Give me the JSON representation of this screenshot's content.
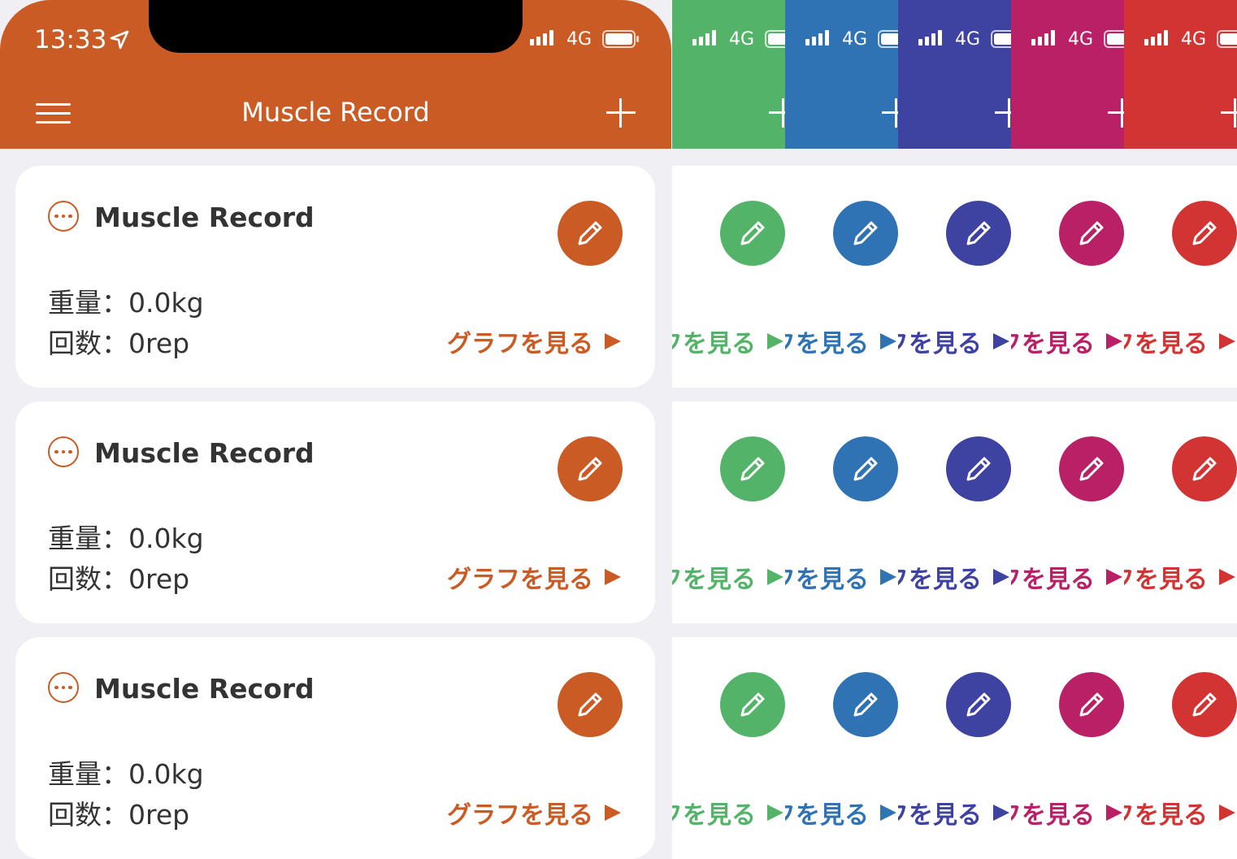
{
  "status_bar": {
    "time": "13:33",
    "network": "4G"
  },
  "header": {
    "title": "Muscle Record"
  },
  "cards": [
    {
      "title": "Muscle Record",
      "weight_text": "重量：0.0kg",
      "reps_text": "回数：0rep",
      "link_label": "グラフを見る"
    },
    {
      "title": "Muscle Record",
      "weight_text": "重量：0.0kg",
      "reps_text": "回数：0rep",
      "link_label": "グラフを見る"
    },
    {
      "title": "Muscle Record",
      "weight_text": "重量：0.0kg",
      "reps_text": "回数：0rep",
      "link_label": "グラフを見る"
    }
  ],
  "themes": [
    {
      "name": "orange",
      "color": "#CB5B24"
    },
    {
      "name": "green",
      "color": "#53B469"
    },
    {
      "name": "blue",
      "color": "#2F73B5"
    },
    {
      "name": "indigo",
      "color": "#3E42A0"
    },
    {
      "name": "magenta",
      "color": "#B92065"
    },
    {
      "name": "red",
      "color": "#D23434"
    }
  ]
}
